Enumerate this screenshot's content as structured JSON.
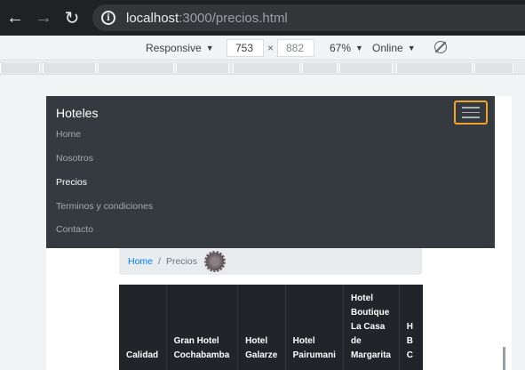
{
  "browser": {
    "url_host": "localhost",
    "url_rest": ":3000/precios.html"
  },
  "device_toolbar": {
    "device": "Responsive",
    "width": "753",
    "height": "882",
    "zoom": "67%",
    "network": "Online"
  },
  "navbar": {
    "brand": "Hoteles",
    "links": [
      "Home",
      "Nosotros",
      "Precios",
      "Terminos y condiciones",
      "Contacto"
    ],
    "active_index": 2
  },
  "breadcrumb": {
    "home": "Home",
    "current": "Precios"
  },
  "table": {
    "headers": [
      "Calidad",
      "Gran Hotel Cochabamba",
      "Hotel Galarze",
      "Hotel Pairumani",
      "Hotel Boutique La Casa de Margarita",
      "H B C"
    ]
  },
  "colors": {
    "navbar_bg": "#343a40",
    "toggler_focus": "#f0a32a",
    "link": "#007bff",
    "table_dark": "#212529"
  }
}
